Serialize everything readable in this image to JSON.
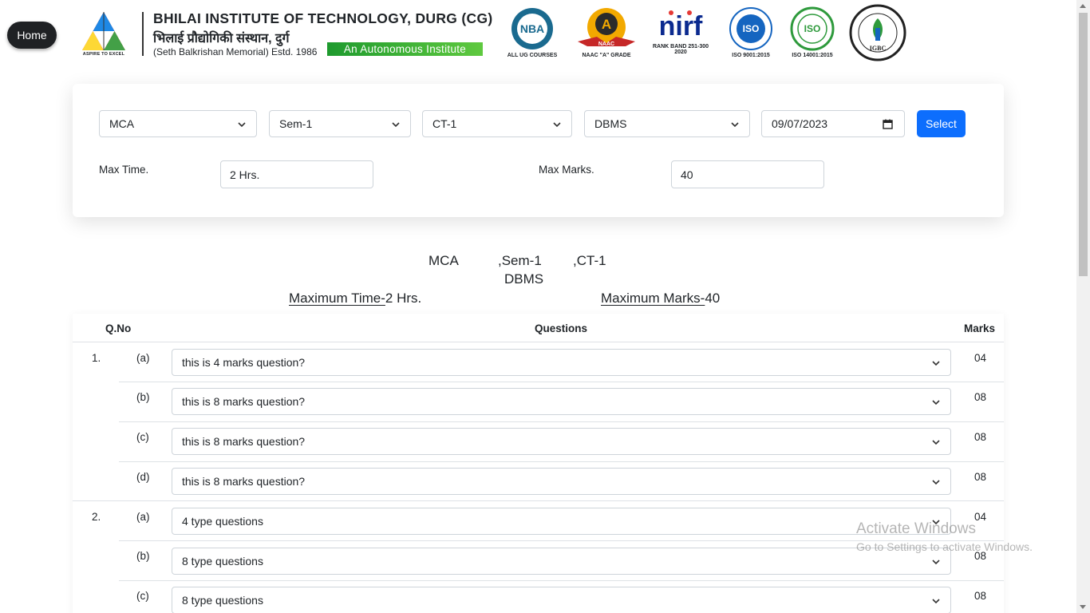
{
  "nav": {
    "home_label": "Home"
  },
  "header": {
    "logo_tagline": "ASPIRE TO EXCEL",
    "institute_name": "BHILAI INSTITUTE OF TECHNOLOGY, DURG (CG)",
    "institute_name_hindi": "भिलाई प्रौद्योगिकी संस्थान, दुर्ग",
    "estd_text": "(Seth Balkrishan Memorial) Estd. 1986",
    "autonomous_banner": "An Autonomous Institute",
    "badges": [
      {
        "icon": "nba-icon",
        "caption": "ALL UG COURSES"
      },
      {
        "icon": "naac-icon",
        "caption": "NAAC \"A\" GRADE"
      },
      {
        "icon": "nirf-icon",
        "caption_line1": "RANK BAND 251-300",
        "caption_line2": "2020"
      },
      {
        "icon": "iso-9001-icon",
        "caption": "ISO 9001:2015"
      },
      {
        "icon": "iso-14001-icon",
        "caption": "ISO 14001:2015"
      },
      {
        "icon": "igbc-icon",
        "caption": ""
      }
    ]
  },
  "filters": {
    "course": "MCA",
    "semester": "Sem-1",
    "test": "CT-1",
    "subject": "DBMS",
    "date": "09/07/2023",
    "select_button": "Select",
    "max_time_label": "Max Time.",
    "max_time_value": "2 Hrs.",
    "max_marks_label": "Max Marks.",
    "max_marks_value": "40"
  },
  "summary": {
    "course": "MCA",
    "semester": ",Sem-1",
    "test": ",CT-1",
    "subject": "DBMS",
    "max_time_label": "Maximum Time-",
    "max_time_value": "2 Hrs.",
    "max_marks_label": "Maximum Marks-",
    "max_marks_value": "40"
  },
  "table": {
    "headers": {
      "qno": "Q.No",
      "questions": "Questions",
      "marks": "Marks"
    },
    "questions": [
      {
        "no": "1.",
        "parts": [
          {
            "sub": "(a)",
            "text": "this is 4 marks question?",
            "marks": "04"
          },
          {
            "sub": "(b)",
            "text": "this is 8 marks question?",
            "marks": "08"
          },
          {
            "sub": "(c)",
            "text": "this is 8 marks question?",
            "marks": "08"
          },
          {
            "sub": "(d)",
            "text": "this is 8 marks question?",
            "marks": "08"
          }
        ]
      },
      {
        "no": "2.",
        "parts": [
          {
            "sub": "(a)",
            "text": "4 type questions",
            "marks": "04"
          },
          {
            "sub": "(b)",
            "text": "8 type questions",
            "marks": "08"
          },
          {
            "sub": "(c)",
            "text": "8 type questions",
            "marks": "08"
          }
        ]
      }
    ]
  },
  "watermark": {
    "line1": "Activate Windows",
    "line2": "Go to Settings to activate Windows."
  }
}
